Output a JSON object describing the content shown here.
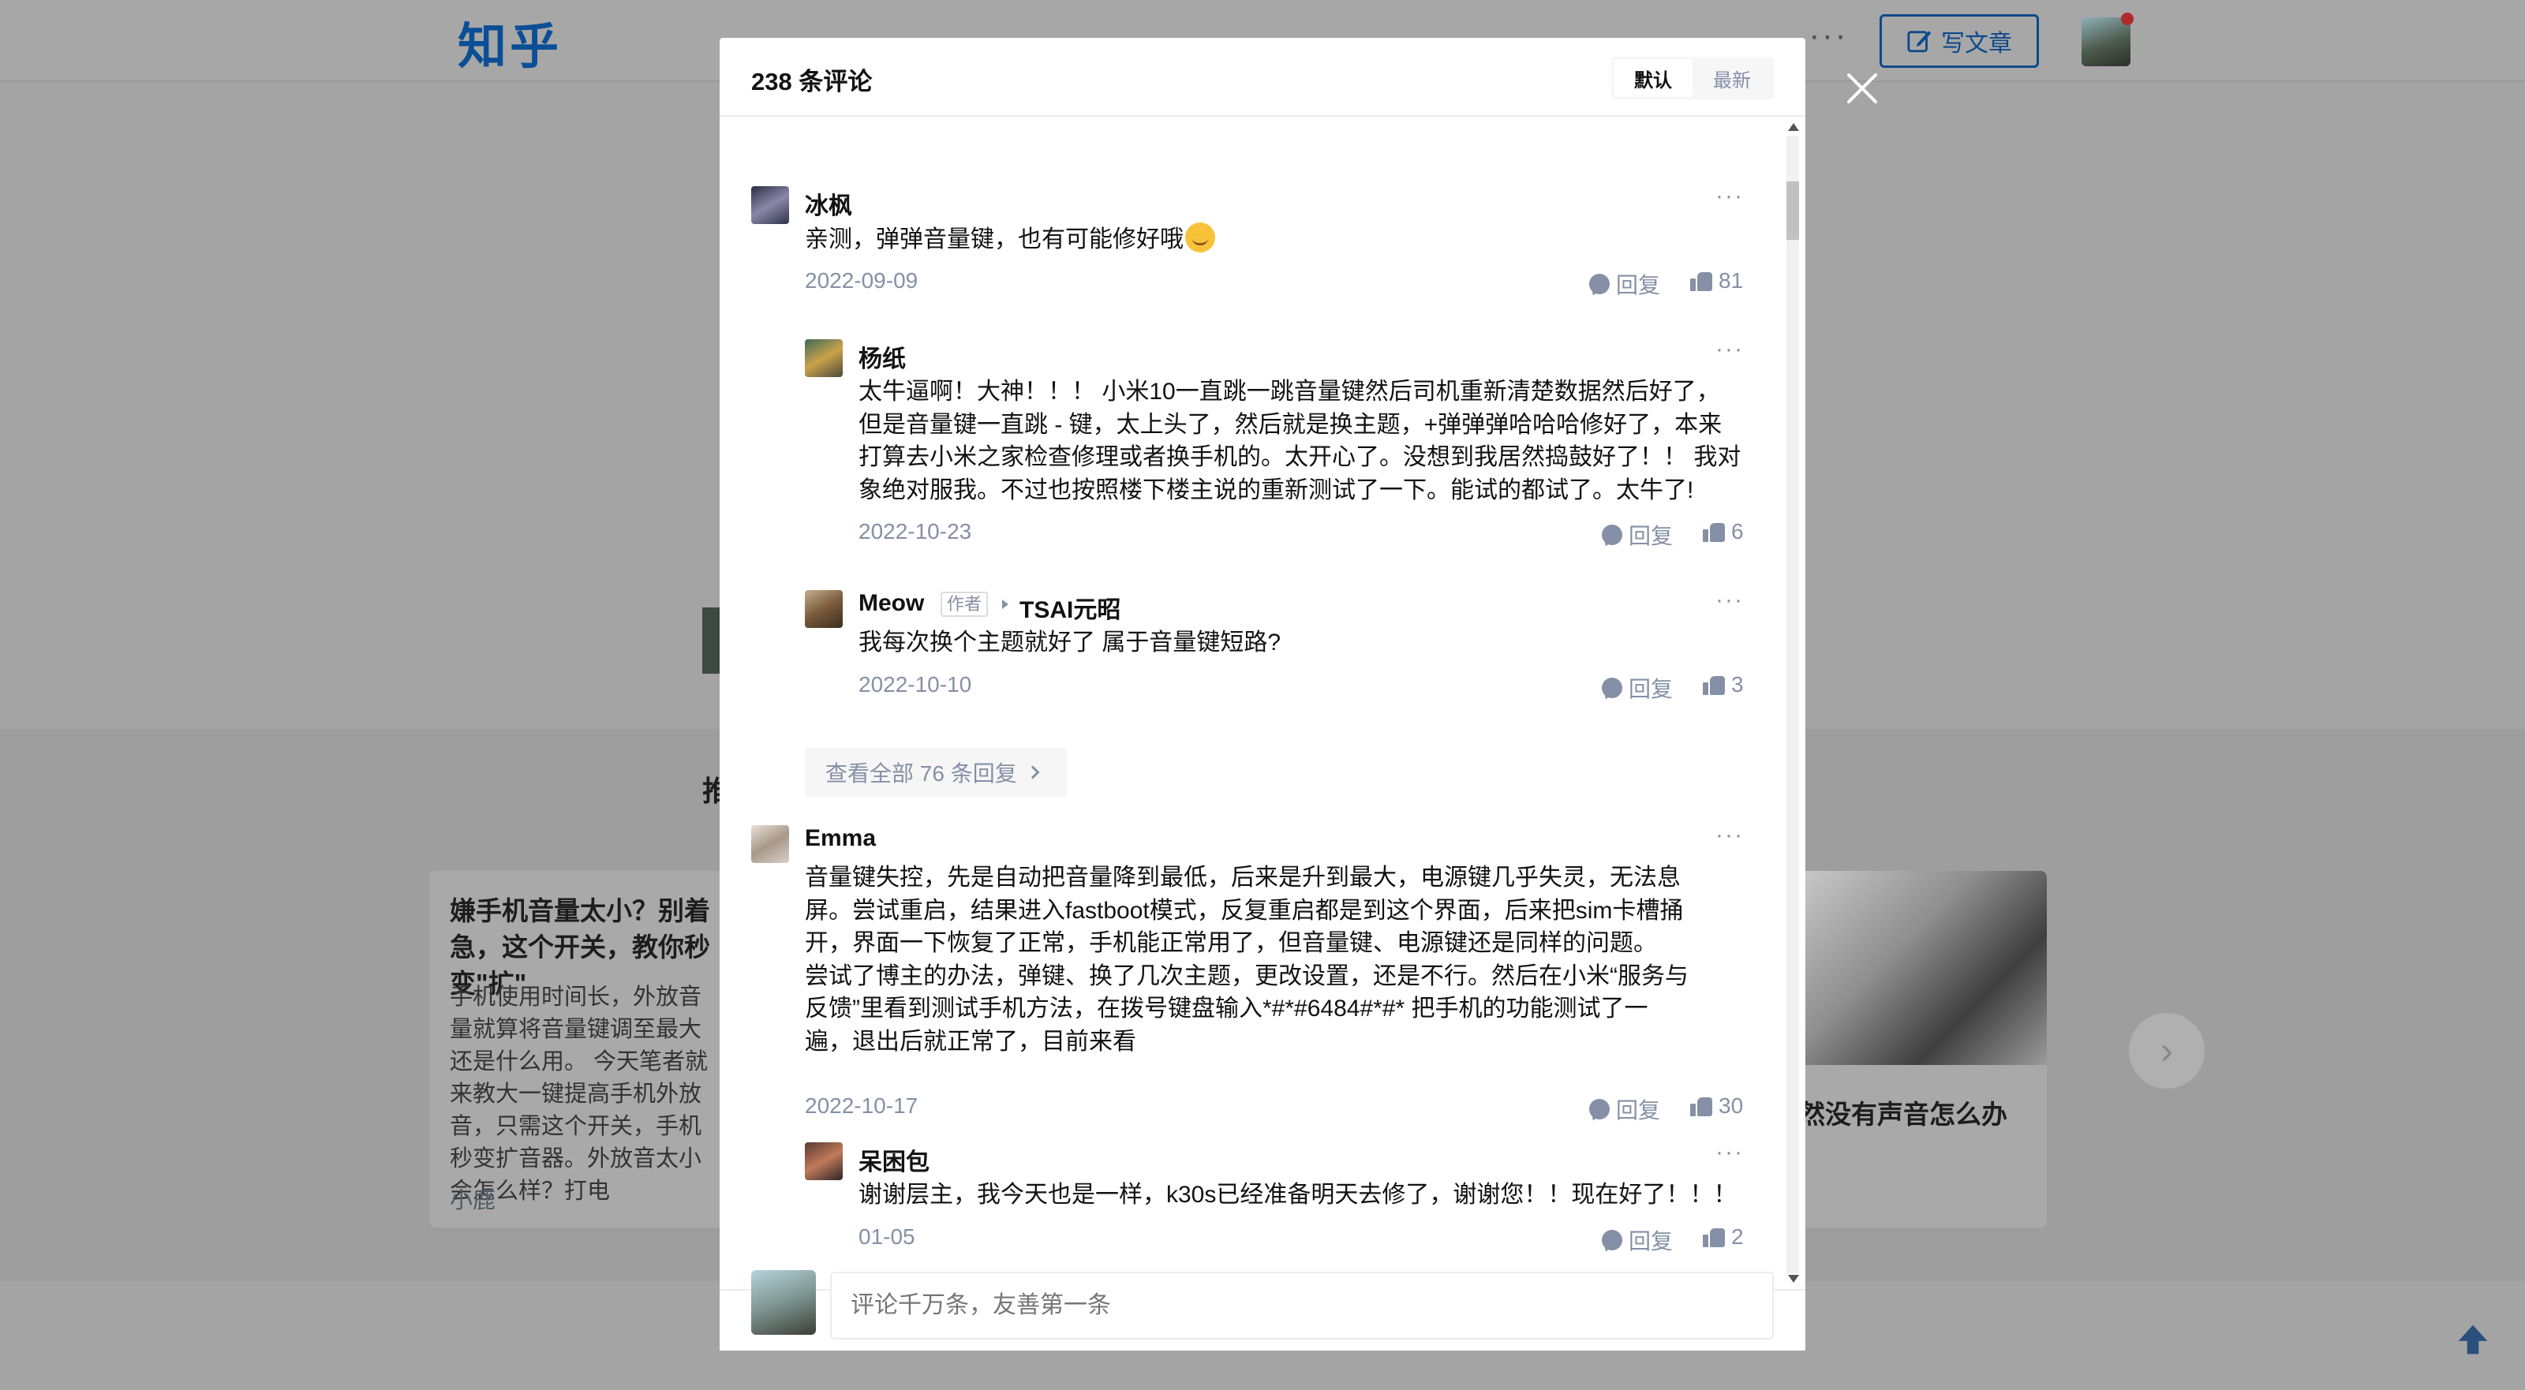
{
  "header": {
    "logo": "知乎",
    "more_dots": "···",
    "write_button": "写文章"
  },
  "background": {
    "section_heading_char": "推",
    "card": {
      "title": "嫌手机音量太小？别着急，这个开关，教你秒变\"扩\"",
      "text": "手机使用时间长，外放音量就算将音量键调至最大还是什么用。 今天笔者就来教大一键提高手机外放音，只需这个开关，手机秒变扩音器。外放音太小会怎么样？打电",
      "author": "小鹿"
    },
    "right_card_title": "然没有声音怎么办"
  },
  "modal": {
    "title": "238 条评论",
    "sort_default": "默认",
    "sort_latest": "最新",
    "comments": [
      {
        "name": "冰枫",
        "text": "亲测，弹弹音量键，也有可能修好哦",
        "date": "2022-09-09",
        "reply": "回复",
        "likes": "81",
        "more": "···"
      },
      {
        "name": "杨纸",
        "text": "太牛逼啊！大神！！！ 小米10一直跳一跳音量键然后司机重新清楚数据然后好了，但是音量键一直跳 - 键，太上头了，然后就是换主题，+弹弹弹哈哈哈修好了，本来打算去小米之家检查修理或者换手机的。太开心了。没想到我居然捣鼓好了！！ 我对象绝对服我。不过也按照楼下楼主说的重新测试了一下。能试的都试了。太牛了!",
        "date": "2022-10-23",
        "reply": "回复",
        "likes": "6",
        "more": "···"
      },
      {
        "name": "Meow",
        "tag": "作者",
        "reply_to": "TSAI元昭",
        "text": "我每次换个主题就好了 属于音量键短路?",
        "date": "2022-10-10",
        "reply": "回复",
        "likes": "3",
        "more": "···"
      },
      {
        "name": "Emma",
        "text": "音量键失控，先是自动把音量降到最低，后来是升到最大，电源键几乎失灵，无法息屏。尝试重启，结果进入fastboot模式，反复重启都是到这个界面，后来把sim卡槽捅开，界面一下恢复了正常，手机能正常用了，但音量键、电源键还是同样的问题。\n尝试了博主的办法，弹键、换了几次主题，更改设置，还是不行。然后在小米“服务与反馈”里看到测试手机方法，在拨号键盘输入*#*#6484#*#* 把手机的功能测试了一遍，退出后就正常了，目前来看",
        "date": "2022-10-17",
        "reply": "回复",
        "likes": "30",
        "more": "···"
      },
      {
        "name": "呆困包",
        "text": "谢谢层主，我今天也是一样，k30s已经准备明天去修了，谢谢您！！现在好了！！！",
        "date": "01-05",
        "reply": "回复",
        "likes": "2",
        "more": "···"
      }
    ],
    "view_all": "查看全部 76 条回复",
    "input_placeholder": "评论千万条，友善第一条"
  }
}
